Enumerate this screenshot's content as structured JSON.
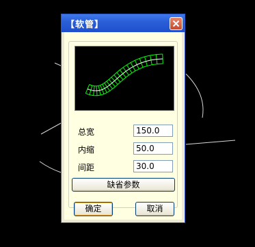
{
  "dialog": {
    "title": "【软管】",
    "fields": [
      {
        "label": "总宽",
        "value": "150.0"
      },
      {
        "label": "内缩",
        "value": "50.0"
      },
      {
        "label": "间距",
        "value": "30.0"
      }
    ],
    "default_params_label": "缺省参数",
    "ok_label": "确定",
    "cancel_label": "取消"
  },
  "colors": {
    "title_bar": "#2a5fd8",
    "client_bg": "#ffffe1",
    "preview_hose": "#00ff00"
  }
}
